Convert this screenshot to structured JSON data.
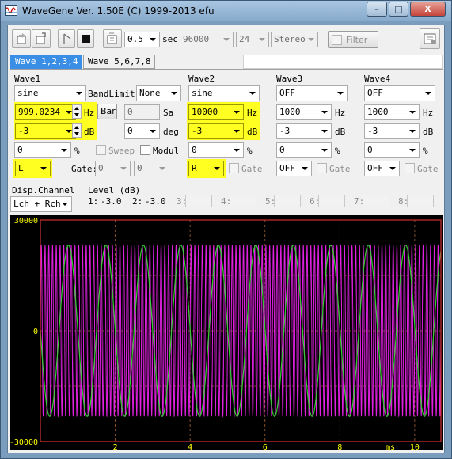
{
  "window": {
    "title": "WaveGene  Ver. 1.50E  (C) 1999-2013 efu",
    "controls": {
      "minimize": "–",
      "maximize": "□",
      "close": "X"
    }
  },
  "toolbar": {
    "duration": "0.5",
    "duration_unit": "sec",
    "sample_rate": "96000",
    "bit_depth": "24",
    "channels": "Stereo",
    "filter_label": "Filter",
    "icons": [
      "open-icon",
      "save-icon",
      "play-icon",
      "stop-icon",
      "sync-icon",
      "settings-icon"
    ]
  },
  "tabs": [
    {
      "label": "Wave 1,2,3,4",
      "active": true
    },
    {
      "label": "Wave 5,6,7,8",
      "active": false
    }
  ],
  "wave1": {
    "title": "Wave1",
    "type": "sine",
    "bandlimit_label": "BandLimit:",
    "bandlimit": "None",
    "frequency": "999.0234",
    "freq_unit": "Hz",
    "bar_button": "Bar",
    "level": "-3",
    "level_unit": "dB",
    "duty": "0",
    "duty_unit": "%",
    "channel": "L",
    "sa_value": "0",
    "sa_unit": "Sa",
    "deg_value": "0",
    "deg_unit": "deg",
    "sweep_label": "Sweep",
    "modul_label": "Modul",
    "gate_label": "Gate:",
    "gate_on": "0",
    "gate_off": "0"
  },
  "wave2": {
    "title": "Wave2",
    "type": "sine",
    "frequency": "10000",
    "freq_unit": "Hz",
    "level": "-3",
    "level_unit": "dB",
    "duty": "0",
    "duty_unit": "%",
    "channel": "R",
    "gate_label": "Gate"
  },
  "wave3": {
    "title": "Wave3",
    "type": "OFF",
    "frequency": "1000",
    "freq_unit": "Hz",
    "level": "-3",
    "level_unit": "dB",
    "duty": "0",
    "duty_unit": "%",
    "channel": "OFF",
    "gate_label": "Gate"
  },
  "wave4": {
    "title": "Wave4",
    "type": "OFF",
    "frequency": "1000",
    "freq_unit": "Hz",
    "level": "-3",
    "level_unit": "dB",
    "duty": "0",
    "duty_unit": "%",
    "channel": "OFF",
    "gate_label": "Gate"
  },
  "display": {
    "channel_label": "Disp.Channel",
    "channel_value": "Lch + Rch",
    "level_label": "Level (dB)",
    "levels": [
      {
        "label": "1:",
        "value": "-3.0"
      },
      {
        "label": "2:",
        "value": "-3.0"
      },
      {
        "label": "3:",
        "value": ""
      },
      {
        "label": "4:",
        "value": ""
      },
      {
        "label": "5:",
        "value": ""
      },
      {
        "label": "6:",
        "value": ""
      },
      {
        "label": "7:",
        "value": ""
      },
      {
        "label": "8:",
        "value": ""
      }
    ]
  },
  "chart_data": {
    "type": "line",
    "xlabel": "ms",
    "x_ticks": [
      "2",
      "4",
      "6",
      "8",
      "10"
    ],
    "xlim": [
      0,
      10.7
    ],
    "y_ticks": [
      "30000",
      "0",
      "-30000"
    ],
    "ylim": [
      -30000,
      30000
    ],
    "grid": true,
    "series": [
      {
        "frequency_hz": 999.0234,
        "amplitude": 23197,
        "color": "#33cc33"
      },
      {
        "frequency_hz": 10000,
        "amplitude": 23197,
        "color": "#e020e0"
      }
    ]
  },
  "colors": {
    "highlight": "#ffff22",
    "tab_active": "#3a8ee6",
    "scope_border": "#d03030",
    "tick_label": "#ffff00"
  }
}
